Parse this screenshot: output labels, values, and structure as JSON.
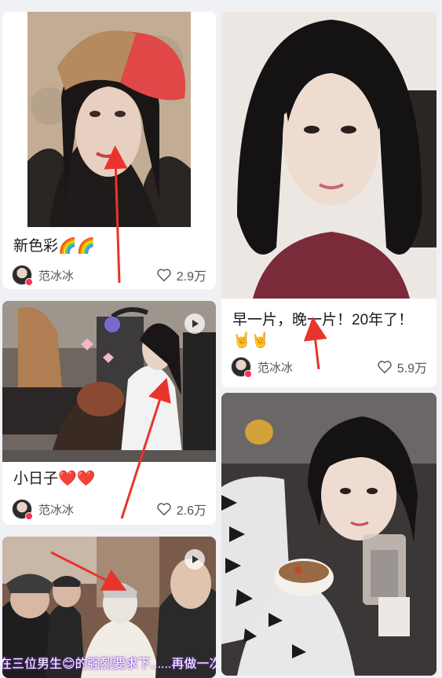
{
  "colors": {
    "background": "#f0f1f5",
    "card": "#ffffff",
    "arrow_red": "#e8342a",
    "text_primary": "#1a1a1a",
    "text_secondary": "#555555"
  },
  "feed": {
    "posts": [
      {
        "title": "新色彩🌈🌈",
        "author": "范冰冰",
        "likes": "2.9万",
        "media": "photo",
        "icon": "heart-outline-icon"
      },
      {
        "title": "小日子❤️❤️",
        "author": "范冰冰",
        "likes": "2.6万",
        "media": "video",
        "icon": "heart-outline-icon"
      },
      {
        "title": "",
        "author": "",
        "likes": "",
        "media": "video",
        "caption_overlay": "在三位男生😊的强烈要求下......再做一次护肤"
      },
      {
        "title_line1": "早一片，晚一片！20年了！",
        "title_line2": "🤘🤘",
        "author": "范冰冰",
        "likes": "5.9万",
        "media": "photo",
        "icon": "heart-outline-icon"
      },
      {
        "title": "",
        "author": "",
        "likes": "",
        "media": "photo"
      }
    ]
  }
}
